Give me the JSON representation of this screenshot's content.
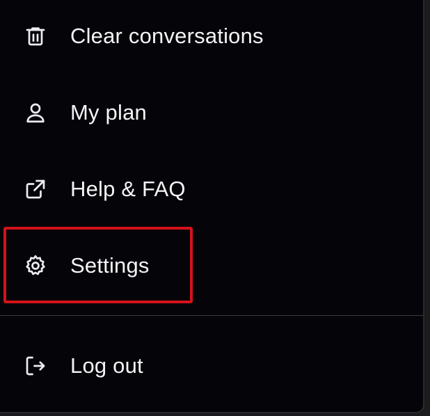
{
  "menu": {
    "items": [
      {
        "label": "Clear conversations",
        "icon": "trash-icon"
      },
      {
        "label": "My plan",
        "icon": "user-icon"
      },
      {
        "label": "Help & FAQ",
        "icon": "external-link-icon"
      },
      {
        "label": "Settings",
        "icon": "gear-icon"
      }
    ],
    "logout": {
      "label": "Log out",
      "icon": "logout-icon"
    }
  },
  "colors": {
    "background": "#050509",
    "text": "#f4f4f6",
    "highlight_border": "#d3121a",
    "divider": "#3a3a40"
  }
}
